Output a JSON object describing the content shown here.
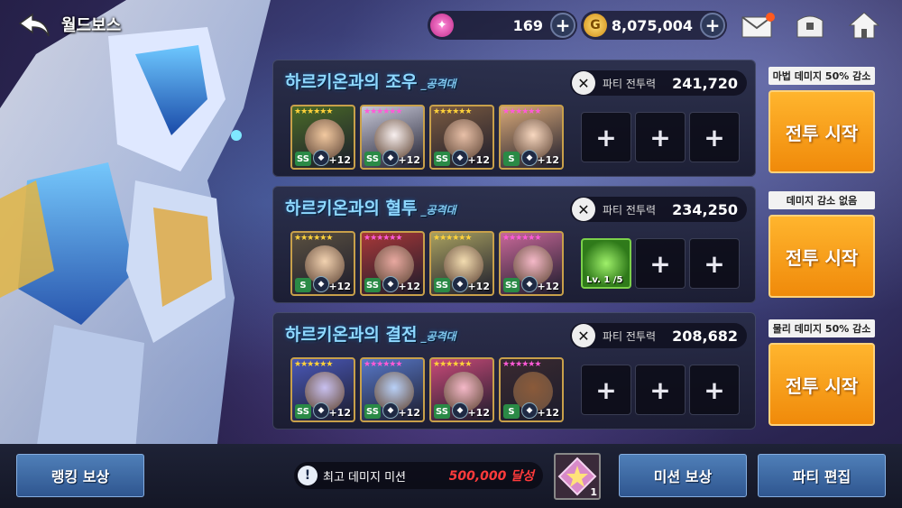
{
  "header": {
    "title": "월드보스",
    "gems": "169",
    "gold": "8,075,004",
    "plus_label": "+",
    "gold_icon_label": "G"
  },
  "parties": [
    {
      "name": "하르키온과의 조우",
      "suffix": "_공격대",
      "power_label": "파티 전투력",
      "power": "241,720",
      "heroes": [
        {
          "badge": "SS",
          "level": "+12",
          "stars": "★★★★★★"
        },
        {
          "badge": "SS",
          "level": "+12",
          "stars": "★★★★★★"
        },
        {
          "badge": "SS",
          "level": "+12",
          "stars": "★★★★★★"
        },
        {
          "badge": "S",
          "level": "+12",
          "stars": "★★★★★★"
        }
      ],
      "empty_slots": [
        "+",
        "+",
        "+"
      ],
      "tag": "마법 데미지 50% 감소",
      "start_label": "전투 시작"
    },
    {
      "name": "하르키온과의 혈투",
      "suffix": "_공격대",
      "power_label": "파티 전투력",
      "power": "234,250",
      "heroes": [
        {
          "badge": "S",
          "level": "+12",
          "stars": "★★★★★★"
        },
        {
          "badge": "SS",
          "level": "+12",
          "stars": "★★★★★★"
        },
        {
          "badge": "SS",
          "level": "+12",
          "stars": "★★★★★★"
        },
        {
          "badge": "SS",
          "level": "+12",
          "stars": "★★★★★★"
        }
      ],
      "pet_level": "Lv. 1 /5",
      "empty_slots": [
        "+",
        "+"
      ],
      "tag": "데미지 감소 없음",
      "start_label": "전투 시작"
    },
    {
      "name": "하르키온과의 결전",
      "suffix": "_공격대",
      "power_label": "파티 전투력",
      "power": "208,682",
      "heroes": [
        {
          "badge": "SS",
          "level": "+12",
          "stars": "★★★★★★"
        },
        {
          "badge": "SS",
          "level": "+12",
          "stars": "★★★★★★"
        },
        {
          "badge": "SS",
          "level": "+12",
          "stars": "★★★★★★"
        },
        {
          "badge": "S",
          "level": "+12",
          "stars": "★★★★★★"
        }
      ],
      "empty_slots": [
        "+",
        "+",
        "+"
      ],
      "tag": "물리 데미지 50% 감소",
      "start_label": "전투 시작"
    }
  ],
  "bottom": {
    "ranking_reward": "랭킹 보상",
    "mission_label": "최고 데미지 미션",
    "mission_goal": "500,000 달성",
    "reward_count": "1",
    "mission_reward": "미션 보상",
    "party_edit": "파티 편집"
  },
  "colors": {
    "accent_orange": "#f5a01a",
    "party_name": "#8fd8ff",
    "mission_goal": "#ff3b3b",
    "button_blue": "#3b6aa6"
  }
}
